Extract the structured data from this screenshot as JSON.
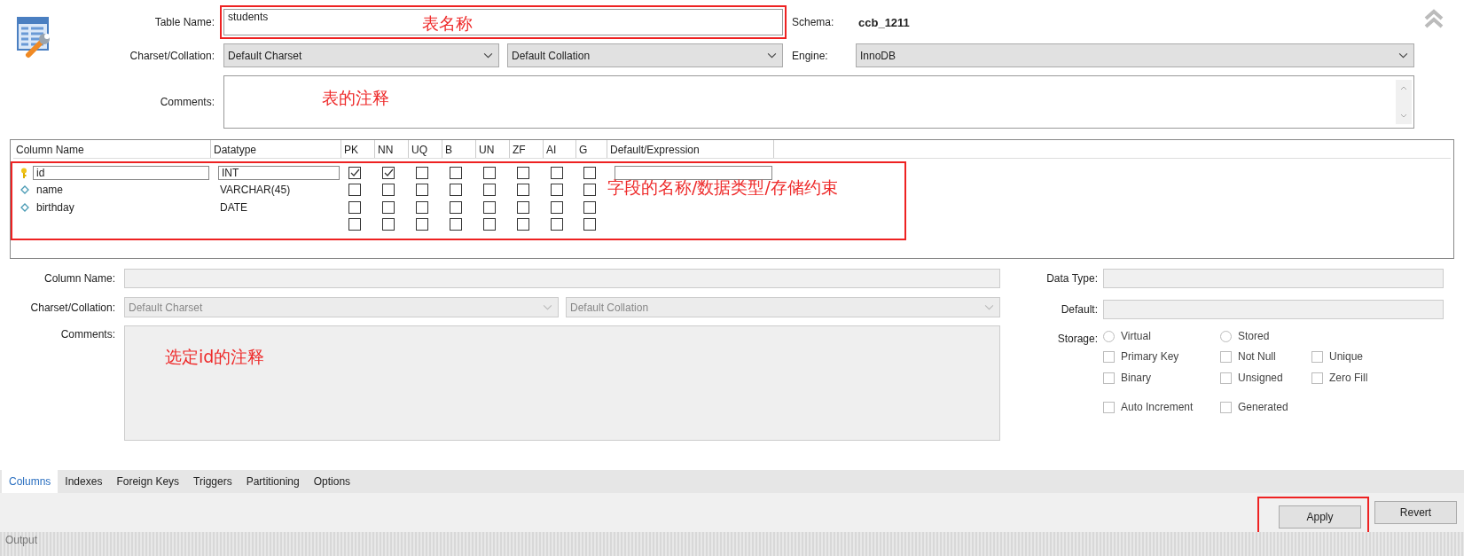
{
  "table_name": {
    "label": "Table Name:",
    "value": "students",
    "highlighted": true,
    "annotation": "表名称"
  },
  "schema": {
    "label": "Schema:",
    "value": "ccb_1211"
  },
  "charset": {
    "label": "Charset/Collation:",
    "charset": "Default Charset",
    "collation": "Default Collation"
  },
  "engine": {
    "label": "Engine:",
    "value": "InnoDB"
  },
  "comments": {
    "label": "Comments:",
    "annotation": "表的注释"
  },
  "grid": {
    "highlighted": true,
    "annotation": "字段的名称/数据类型/存储约束",
    "columns": [
      "Column Name",
      "Datatype",
      "PK",
      "NN",
      "UQ",
      "B",
      "UN",
      "ZF",
      "AI",
      "G",
      "Default/Expression"
    ],
    "rows": [
      {
        "kind": "primary",
        "name": "id",
        "datatype": "INT",
        "selected": true,
        "flags": [
          true,
          true,
          false,
          false,
          false,
          false,
          false,
          false
        ]
      },
      {
        "kind": "column",
        "name": "name",
        "datatype": "VARCHAR(45)",
        "selected": false,
        "flags": [
          false,
          false,
          false,
          false,
          false,
          false,
          false,
          false
        ]
      },
      {
        "kind": "column",
        "name": "birthday",
        "datatype": "DATE",
        "selected": false,
        "flags": [
          false,
          false,
          false,
          false,
          false,
          false,
          false,
          false
        ]
      },
      {
        "kind": "new",
        "selected": false,
        "flags": [
          false,
          false,
          false,
          false,
          false,
          false,
          false,
          false
        ]
      }
    ]
  },
  "details": {
    "column_name_label": "Column Name:",
    "charset_label": "Charset/Collation:",
    "charset": "Default Charset",
    "collation": "Default Collation",
    "comments_label": "Comments:",
    "comments_annotation": "选定id的注释",
    "data_type_label": "Data Type:",
    "default_label": "Default:",
    "storage_label": "Storage:",
    "storage": [
      {
        "label": "Virtual",
        "checked": false
      },
      {
        "label": "Stored",
        "checked": false
      }
    ],
    "options": [
      {
        "label": "Primary Key",
        "checked": false
      },
      {
        "label": "Not Null",
        "checked": false
      },
      {
        "label": "Unique",
        "checked": false
      },
      {
        "label": "Binary",
        "checked": false
      },
      {
        "label": "Unsigned",
        "checked": false
      },
      {
        "label": "Zero Fill",
        "checked": false
      },
      {
        "label": "Auto Increment",
        "checked": false
      },
      {
        "label": "Generated",
        "checked": false
      }
    ]
  },
  "tabs": [
    {
      "label": "Columns",
      "selected": true
    },
    {
      "label": "Indexes",
      "selected": false
    },
    {
      "label": "Foreign Keys",
      "selected": false
    },
    {
      "label": "Triggers",
      "selected": false
    },
    {
      "label": "Partitioning",
      "selected": false
    },
    {
      "label": "Options",
      "selected": false
    }
  ],
  "buttons": [
    {
      "label": "Apply",
      "highlighted": true
    },
    {
      "label": "Revert",
      "highlighted": false
    }
  ],
  "output": {
    "label": "Output"
  }
}
